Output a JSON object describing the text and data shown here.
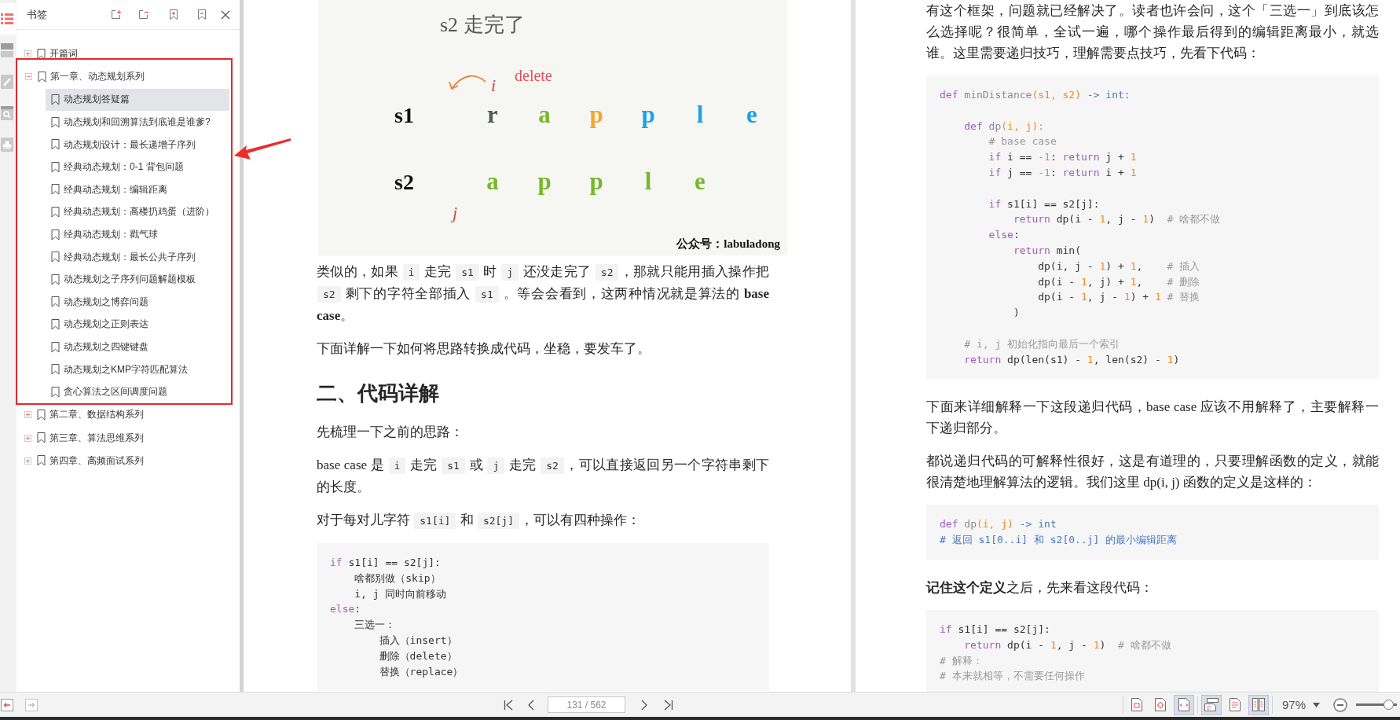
{
  "side_tabs": [
    {
      "kind": "bookmarks",
      "selected": true
    },
    {
      "kind": "pages",
      "selected": false
    },
    {
      "kind": "comments",
      "selected": false
    },
    {
      "kind": "search",
      "selected": false
    },
    {
      "kind": "stamps",
      "selected": false
    }
  ],
  "bookmarks_panel": {
    "title": "书签",
    "items": [
      {
        "label": "开篇词",
        "expanded": false,
        "annotated": false,
        "selected": false
      },
      {
        "label": "第一章、动态规划系列",
        "expanded": true,
        "annotated": true,
        "selected": false,
        "children": [
          {
            "label": "动态规划答疑篇",
            "selected": true
          },
          {
            "label": "动态规划和回溯算法到底谁是谁爹?",
            "selected": false
          },
          {
            "label": "动态规划设计：最长递增子序列",
            "selected": false
          },
          {
            "label": "经典动态规划：0-1 背包问题",
            "selected": false
          },
          {
            "label": "经典动态规划：编辑距离",
            "selected": false
          },
          {
            "label": "经典动态规划：高楼扔鸡蛋（进阶）",
            "selected": false
          },
          {
            "label": "经典动态规划：戳气球",
            "selected": false
          },
          {
            "label": "经典动态规划：最长公共子序列",
            "selected": false
          },
          {
            "label": "动态规划之子序列问题解题模板",
            "selected": false
          },
          {
            "label": "动态规划之博弈问题",
            "selected": false
          },
          {
            "label": "动态规划之正则表达",
            "selected": false
          },
          {
            "label": "动态规划之四键键盘",
            "selected": false
          },
          {
            "label": "动态规划之KMP字符匹配算法",
            "selected": false
          },
          {
            "label": "贪心算法之区间调度问题",
            "selected": false
          }
        ]
      },
      {
        "label": "第二章、数据结构系列",
        "expanded": false,
        "annotated": false,
        "selected": false
      },
      {
        "label": "第三章、算法思维系列",
        "expanded": false,
        "annotated": false,
        "selected": false
      },
      {
        "label": "第四章、高频面试系列",
        "expanded": false,
        "annotated": false,
        "selected": false
      }
    ]
  },
  "pages": [
    {
      "blocks": [
        {
          "kind": "figure",
          "title": "s2 走完了",
          "pointer_s1": "i",
          "action": "delete",
          "rows": [
            {
              "label": "s1",
              "letters": [
                {
                  "text": "r",
                  "color": "#555a5f"
                },
                {
                  "text": "a",
                  "color": "#76b82a"
                },
                {
                  "text": "p",
                  "color": "#f5a52a"
                },
                {
                  "text": "p",
                  "color": "#1aa2e8"
                },
                {
                  "text": "l",
                  "color": "#1aa2e8"
                },
                {
                  "text": "e",
                  "color": "#1aa2e8"
                }
              ]
            },
            {
              "label": "s2",
              "letters": [
                {
                  "text": "a",
                  "color": "#76b82a"
                },
                {
                  "text": "p",
                  "color": "#76b82a"
                },
                {
                  "text": "p",
                  "color": "#76b82a"
                },
                {
                  "text": "l",
                  "color": "#76b82a"
                },
                {
                  "text": "e",
                  "color": "#76b82a"
                }
              ]
            }
          ],
          "pointer_s2": "j",
          "credit": "公众号：labuladong"
        },
        {
          "kind": "paragraph",
          "runs": [
            {
              "kind": "text",
              "text": "类似的，如果 "
            },
            {
              "kind": "code",
              "text": "i"
            },
            {
              "kind": "text",
              "text": " 走完 "
            },
            {
              "kind": "code",
              "text": "s1"
            },
            {
              "kind": "text",
              "text": " 时 "
            },
            {
              "kind": "code",
              "text": "j"
            },
            {
              "kind": "text",
              "text": " 还没走完了 "
            },
            {
              "kind": "code",
              "text": "s2"
            },
            {
              "kind": "text",
              "text": "，那就只能用插入操作把 "
            },
            {
              "kind": "code",
              "text": "s2"
            },
            {
              "kind": "text",
              "text": " 剩下的字符全部插入 "
            },
            {
              "kind": "code",
              "text": "s1"
            },
            {
              "kind": "text",
              "text": " 。等会会看到，这两种情况就是算法的 **base case**。"
            }
          ]
        },
        {
          "kind": "paragraph",
          "runs": [
            {
              "kind": "text",
              "text": "下面详解一下如何将思路转换成代码，坐稳，要发车了。"
            }
          ]
        },
        {
          "kind": "heading",
          "text": "二、代码详解"
        },
        {
          "kind": "paragraph",
          "runs": [
            {
              "kind": "text",
              "text": "先梳理一下之前的思路："
            }
          ]
        },
        {
          "kind": "paragraph",
          "runs": [
            {
              "kind": "text",
              "text": "base case 是 "
            },
            {
              "kind": "code",
              "text": "i"
            },
            {
              "kind": "text",
              "text": " 走完 "
            },
            {
              "kind": "code",
              "text": "s1"
            },
            {
              "kind": "text",
              "text": " 或 "
            },
            {
              "kind": "code",
              "text": "j"
            },
            {
              "kind": "text",
              "text": " 走完 "
            },
            {
              "kind": "code",
              "text": "s2"
            },
            {
              "kind": "text",
              "text": "，可以直接返回另一个字符串剩下的长度。"
            }
          ]
        },
        {
          "kind": "paragraph",
          "runs": [
            {
              "kind": "text",
              "text": "对于每对儿字符 "
            },
            {
              "kind": "code",
              "text": "s1[i]"
            },
            {
              "kind": "text",
              "text": " 和 "
            },
            {
              "kind": "code",
              "text": "s2[j]"
            },
            {
              "kind": "text",
              "text": "，可以有四种操作："
            }
          ]
        },
        {
          "kind": "code",
          "lines": [
            {
              "kind": "line",
              "tokens": [
                {
                  "kind": "keyword",
                  "text": "if"
                },
                {
                  "kind": "plain",
                  "text": " s1[i] == s2[j]:"
                }
              ],
              "children": [
                {
                  "kind": "line",
                  "tokens": [
                    {
                      "kind": "plain",
                      "text": "啥都别做（skip）"
                    }
                  ]
                },
                {
                  "kind": "line",
                  "tokens": [
                    {
                      "kind": "plain",
                      "text": "i, j 同时向前移动"
                    }
                  ]
                }
              ]
            },
            {
              "kind": "line",
              "tokens": [
                {
                  "kind": "keyword",
                  "text": "else"
                },
                {
                  "kind": "plain",
                  "text": ":"
                }
              ],
              "children": [
                {
                  "kind": "line",
                  "tokens": [
                    {
                      "kind": "plain",
                      "text": "三选一："
                    }
                  ],
                  "children": [
                    {
                      "kind": "line",
                      "tokens": [
                        {
                          "kind": "plain",
                          "text": "插入（insert）"
                        }
                      ]
                    },
                    {
                      "kind": "line",
                      "tokens": [
                        {
                          "kind": "plain",
                          "text": "删除（delete）"
                        }
                      ]
                    },
                    {
                      "kind": "line",
                      "tokens": [
                        {
                          "kind": "plain",
                          "text": "替换（replace）"
                        }
                      ]
                    }
                  ]
                }
              ]
            }
          ]
        }
      ]
    },
    {
      "blocks": [
        {
          "kind": "paragraph",
          "runs": [
            {
              "kind": "text",
              "text": "有这个框架，问题就已经解决了。读者也许会问，这个「三选一」到底该怎么选择呢？很简单，全试一遍，哪个操作最后得到的编辑距离最小，就选谁。这里需要递归技巧，理解需要点技巧，先看下代码："
            }
          ]
        },
        {
          "kind": "code",
          "lines": [
            {
              "kind": "line",
              "tokens": [
                {
                  "kind": "keyword",
                  "text": "def"
                },
                {
                  "kind": "function",
                  "text": " minDistance"
                },
                {
                  "kind": "param",
                  "text": "(s1, s2)"
                },
                {
                  "kind": "hint",
                  "text": " -> int:"
                }
              ],
              "children": [
                {
                  "kind": "blank"
                },
                {
                  "kind": "line",
                  "tokens": [
                    {
                      "kind": "keyword",
                      "text": "def"
                    },
                    {
                      "kind": "function",
                      "text": " dp"
                    },
                    {
                      "kind": "param",
                      "text": "(i, j):"
                    }
                  ],
                  "children": [
                    {
                      "kind": "line",
                      "tokens": [
                        {
                          "kind": "comment",
                          "text": "# base case"
                        }
                      ]
                    },
                    {
                      "kind": "line",
                      "tokens": [
                        {
                          "kind": "keyword",
                          "text": "if"
                        },
                        {
                          "kind": "plain",
                          "text": " i == "
                        },
                        {
                          "kind": "number",
                          "text": "-1"
                        },
                        {
                          "kind": "plain",
                          "text": ": "
                        },
                        {
                          "kind": "keyword",
                          "text": "return"
                        },
                        {
                          "kind": "plain",
                          "text": " j + "
                        },
                        {
                          "kind": "number",
                          "text": "1"
                        }
                      ]
                    },
                    {
                      "kind": "line",
                      "tokens": [
                        {
                          "kind": "keyword",
                          "text": "if"
                        },
                        {
                          "kind": "plain",
                          "text": " j == "
                        },
                        {
                          "kind": "number",
                          "text": "-1"
                        },
                        {
                          "kind": "plain",
                          "text": ": "
                        },
                        {
                          "kind": "keyword",
                          "text": "return"
                        },
                        {
                          "kind": "plain",
                          "text": " i + "
                        },
                        {
                          "kind": "number",
                          "text": "1"
                        }
                      ]
                    },
                    {
                      "kind": "blank"
                    },
                    {
                      "kind": "line",
                      "tokens": [
                        {
                          "kind": "keyword",
                          "text": "if"
                        },
                        {
                          "kind": "plain",
                          "text": " s1[i] == s2[j]:"
                        }
                      ],
                      "children": [
                        {
                          "kind": "line",
                          "tokens": [
                            {
                              "kind": "keyword",
                              "text": "return"
                            },
                            {
                              "kind": "plain",
                              "text": " dp(i - "
                            },
                            {
                              "kind": "number",
                              "text": "1"
                            },
                            {
                              "kind": "plain",
                              "text": ", j - "
                            },
                            {
                              "kind": "number",
                              "text": "1"
                            },
                            {
                              "kind": "plain",
                              "text": ")  "
                            },
                            {
                              "kind": "comment",
                              "text": "# 啥都不做"
                            }
                          ]
                        }
                      ]
                    },
                    {
                      "kind": "line",
                      "tokens": [
                        {
                          "kind": "keyword",
                          "text": "else"
                        },
                        {
                          "kind": "plain",
                          "text": ":"
                        }
                      ],
                      "children": [
                        {
                          "kind": "line",
                          "tokens": [
                            {
                              "kind": "keyword",
                              "text": "return"
                            },
                            {
                              "kind": "plain",
                              "text": " min("
                            }
                          ],
                          "children": [
                            {
                              "kind": "line",
                              "tokens": [
                                {
                                  "kind": "plain",
                                  "text": "dp(i, j - "
                                },
                                {
                                  "kind": "number",
                                  "text": "1"
                                },
                                {
                                  "kind": "plain",
                                  "text": ") + "
                                },
                                {
                                  "kind": "number",
                                  "text": "1"
                                },
                                {
                                  "kind": "plain",
                                  "text": ",    "
                                },
                                {
                                  "kind": "comment",
                                  "text": "# 插入"
                                }
                              ]
                            },
                            {
                              "kind": "line",
                              "tokens": [
                                {
                                  "kind": "plain",
                                  "text": "dp(i - "
                                },
                                {
                                  "kind": "number",
                                  "text": "1"
                                },
                                {
                                  "kind": "plain",
                                  "text": ", j) + "
                                },
                                {
                                  "kind": "number",
                                  "text": "1"
                                },
                                {
                                  "kind": "plain",
                                  "text": ",    "
                                },
                                {
                                  "kind": "comment",
                                  "text": "# 删除"
                                }
                              ]
                            },
                            {
                              "kind": "line",
                              "tokens": [
                                {
                                  "kind": "plain",
                                  "text": "dp(i - "
                                },
                                {
                                  "kind": "number",
                                  "text": "1"
                                },
                                {
                                  "kind": "plain",
                                  "text": ", j - "
                                },
                                {
                                  "kind": "number",
                                  "text": "1"
                                },
                                {
                                  "kind": "plain",
                                  "text": ") + "
                                },
                                {
                                  "kind": "number",
                                  "text": "1"
                                },
                                {
                                  "kind": "comment",
                                  "text": " # 替换"
                                }
                              ]
                            }
                          ]
                        },
                        {
                          "kind": "line",
                          "tokens": [
                            {
                              "kind": "plain",
                              "text": ")"
                            }
                          ]
                        }
                      ]
                    }
                  ]
                },
                {
                  "kind": "blank"
                },
                {
                  "kind": "line",
                  "tokens": [
                    {
                      "kind": "comment",
                      "text": "# i, j 初始化指向最后一个索引"
                    }
                  ]
                },
                {
                  "kind": "line",
                  "tokens": [
                    {
                      "kind": "keyword",
                      "text": "return"
                    },
                    {
                      "kind": "plain",
                      "text": " dp(len(s1) - "
                    },
                    {
                      "kind": "number",
                      "text": "1"
                    },
                    {
                      "kind": "plain",
                      "text": ", len(s2) - "
                    },
                    {
                      "kind": "number",
                      "text": "1"
                    },
                    {
                      "kind": "plain",
                      "text": ")"
                    }
                  ]
                }
              ]
            }
          ]
        },
        {
          "kind": "paragraph",
          "runs": [
            {
              "kind": "text",
              "text": "下面来详细解释一下这段递归代码，base case 应该不用解释了，主要解释一下递归部分。"
            }
          ]
        },
        {
          "kind": "paragraph",
          "runs": [
            {
              "kind": "text",
              "text": "都说递归代码的可解释性很好，这是有道理的，只要理解函数的定义，就能很清楚地理解算法的逻辑。我们这里 dp(i, j) 函数的定义是这样的："
            }
          ]
        },
        {
          "kind": "code",
          "lines": [
            {
              "kind": "line",
              "tokens": [
                {
                  "kind": "keyword",
                  "text": "def"
                },
                {
                  "kind": "function",
                  "text": " dp"
                },
                {
                  "kind": "param",
                  "text": "(i, j)"
                },
                {
                  "kind": "hint",
                  "text": " -> int"
                }
              ]
            },
            {
              "kind": "line",
              "tokens": [
                {
                  "kind": "hint",
                  "text": "# 返回 s1[0..i] 和 s2[0..j] 的最小编辑距离"
                }
              ]
            }
          ]
        },
        {
          "kind": "paragraph",
          "runs": [
            {
              "kind": "text",
              "text": "**记住这个定义**之后，先来看这段代码："
            }
          ]
        },
        {
          "kind": "code",
          "lines": [
            {
              "kind": "line",
              "tokens": [
                {
                  "kind": "keyword",
                  "text": "if"
                },
                {
                  "kind": "plain",
                  "text": " s1[i] == s2[j]:"
                }
              ],
              "children": [
                {
                  "kind": "line",
                  "tokens": [
                    {
                      "kind": "keyword",
                      "text": "return"
                    },
                    {
                      "kind": "plain",
                      "text": " dp(i - "
                    },
                    {
                      "kind": "number",
                      "text": "1"
                    },
                    {
                      "kind": "plain",
                      "text": ", j - "
                    },
                    {
                      "kind": "number",
                      "text": "1"
                    },
                    {
                      "kind": "plain",
                      "text": ")  "
                    },
                    {
                      "kind": "comment",
                      "text": "# 啥都不做"
                    }
                  ]
                }
              ]
            },
            {
              "kind": "line",
              "tokens": [
                {
                  "kind": "comment",
                  "text": "# 解释："
                }
              ]
            },
            {
              "kind": "line",
              "tokens": [
                {
                  "kind": "comment",
                  "text": "# 本来就相等，不需要任何操作"
                }
              ]
            }
          ]
        }
      ]
    }
  ],
  "status_bar": {
    "history_buttons": [
      {
        "kind": "back",
        "disabled": false
      },
      {
        "kind": "forward",
        "disabled": true
      }
    ],
    "page_field": "131 / 562",
    "view_buttons": [
      {
        "kind": "actual_size",
        "selected": false
      },
      {
        "kind": "fit_page",
        "selected": false
      },
      {
        "kind": "fit_width",
        "selected": true
      },
      {
        "kind": "single_page",
        "selected": true
      },
      {
        "kind": "continuous",
        "selected": false
      },
      {
        "kind": "facing",
        "selected": true
      }
    ],
    "zoom": "97%",
    "zoom_slider": {
      "level": 0.9
    }
  }
}
